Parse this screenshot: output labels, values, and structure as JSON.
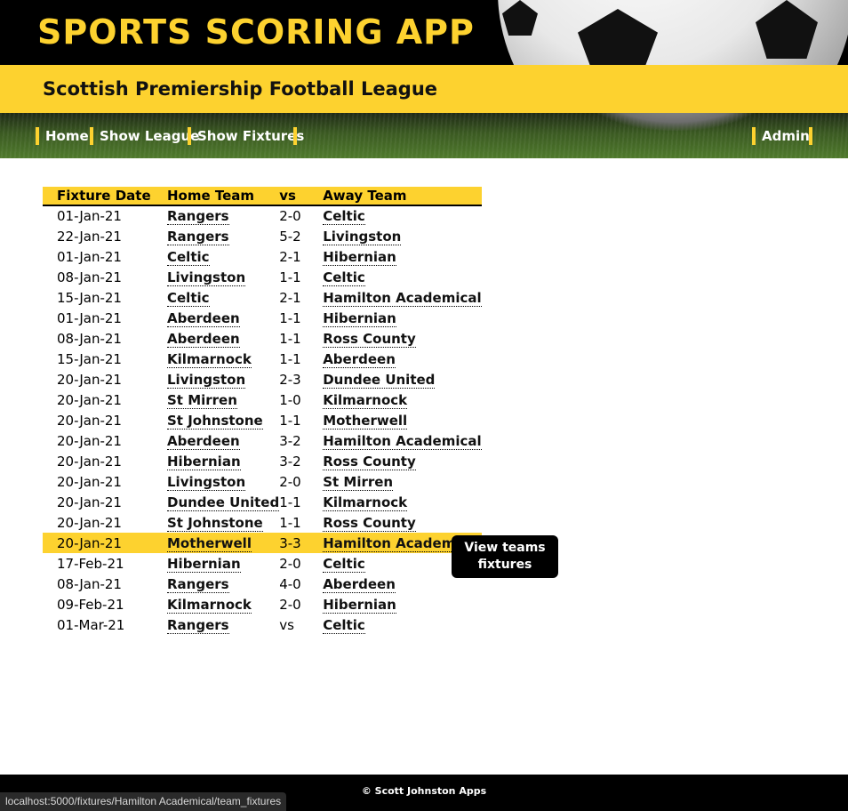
{
  "header": {
    "app_title": "SPORTS SCORING APP"
  },
  "league": {
    "title": "Scottish Premiership Football League"
  },
  "nav": {
    "items": [
      {
        "label": "Home"
      },
      {
        "label": "Show League"
      },
      {
        "label": "Show Fixtures"
      }
    ],
    "admin_label": "Admin"
  },
  "fixtures": {
    "columns": [
      "Fixture Date",
      "Home Team",
      "vs",
      "Away Team"
    ],
    "rows": [
      {
        "date": "01-Jan-21",
        "home": "Rangers",
        "score": "2-0",
        "away": "Celtic"
      },
      {
        "date": "22-Jan-21",
        "home": "Rangers",
        "score": "5-2",
        "away": "Livingston"
      },
      {
        "date": "01-Jan-21",
        "home": "Celtic",
        "score": "2-1",
        "away": "Hibernian"
      },
      {
        "date": "08-Jan-21",
        "home": "Livingston",
        "score": "1-1",
        "away": "Celtic"
      },
      {
        "date": "15-Jan-21",
        "home": "Celtic",
        "score": "2-1",
        "away": "Hamilton Academical"
      },
      {
        "date": "01-Jan-21",
        "home": "Aberdeen",
        "score": "1-1",
        "away": "Hibernian"
      },
      {
        "date": "08-Jan-21",
        "home": "Aberdeen",
        "score": "1-1",
        "away": "Ross County"
      },
      {
        "date": "15-Jan-21",
        "home": "Kilmarnock",
        "score": "1-1",
        "away": "Aberdeen"
      },
      {
        "date": "20-Jan-21",
        "home": "Livingston",
        "score": "2-3",
        "away": "Dundee United"
      },
      {
        "date": "20-Jan-21",
        "home": "St Mirren",
        "score": "1-0",
        "away": "Kilmarnock"
      },
      {
        "date": "20-Jan-21",
        "home": "St Johnstone",
        "score": "1-1",
        "away": "Motherwell"
      },
      {
        "date": "20-Jan-21",
        "home": "Aberdeen",
        "score": "3-2",
        "away": "Hamilton Academical"
      },
      {
        "date": "20-Jan-21",
        "home": "Hibernian",
        "score": "3-2",
        "away": "Ross County"
      },
      {
        "date": "20-Jan-21",
        "home": "Livingston",
        "score": "2-0",
        "away": "St Mirren"
      },
      {
        "date": "20-Jan-21",
        "home": "Dundee United",
        "score": "1-1",
        "away": "Kilmarnock"
      },
      {
        "date": "20-Jan-21",
        "home": "St Johnstone",
        "score": "1-1",
        "away": "Ross County"
      },
      {
        "date": "20-Jan-21",
        "home": "Motherwell",
        "score": "3-3",
        "away": "Hamilton Academical",
        "highlighted": true
      },
      {
        "date": "17-Feb-21",
        "home": "Hibernian",
        "score": "2-0",
        "away": "Celtic"
      },
      {
        "date": "08-Jan-21",
        "home": "Rangers",
        "score": "4-0",
        "away": "Aberdeen"
      },
      {
        "date": "09-Feb-21",
        "home": "Kilmarnock",
        "score": "2-0",
        "away": "Hibernian"
      },
      {
        "date": "01-Mar-21",
        "home": "Rangers",
        "score": "vs",
        "away": "Celtic"
      }
    ]
  },
  "tooltip": {
    "text": "View teams\nfixtures"
  },
  "footer": {
    "text": "© Scott Johnston Apps"
  },
  "status_bar": {
    "url": "localhost:5000/fixtures/Hamilton Academical/team_fixtures"
  },
  "colors": {
    "accent": "#fdd22f",
    "dark": "#000000"
  }
}
